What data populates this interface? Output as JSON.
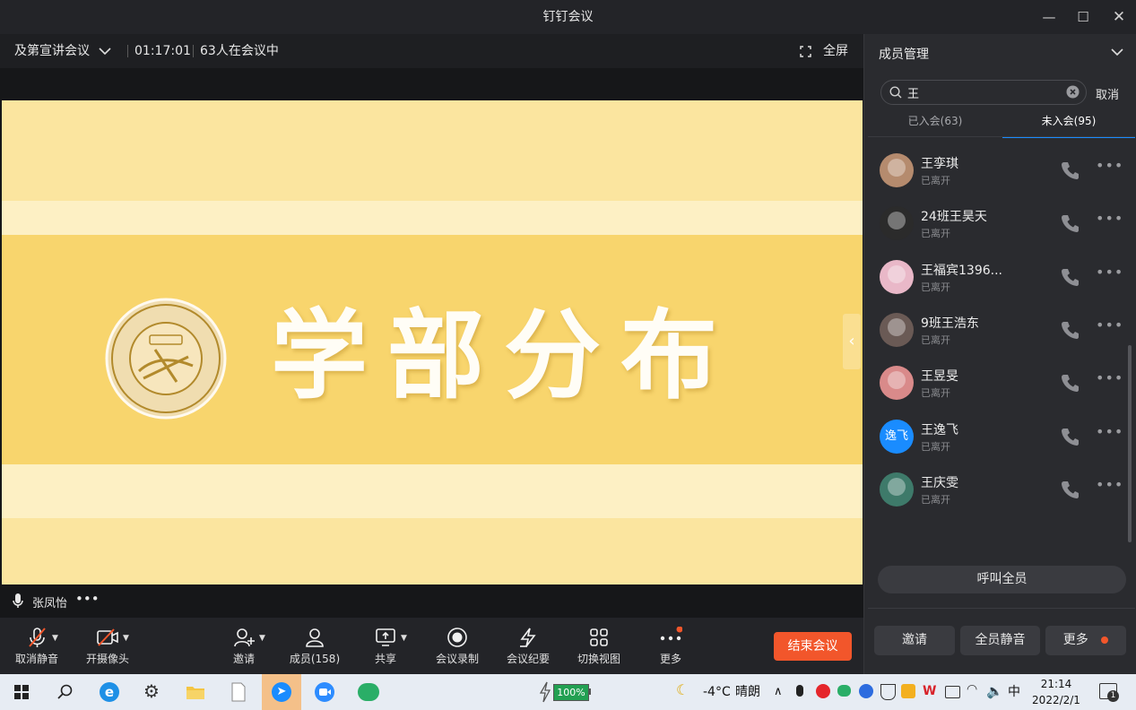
{
  "window": {
    "title": "钉钉会议"
  },
  "meeting": {
    "name": "及第宣讲会议",
    "duration": "01:17:01",
    "participants": "63人在会议中",
    "fullscreen_label": "全屏"
  },
  "slide": {
    "title": "学部分布"
  },
  "speaker": {
    "name": "张凤怡",
    "more": "•••"
  },
  "toolbar": {
    "mute": "取消静音",
    "camera": "开摄像头",
    "invite": "邀请",
    "members": "成员(158)",
    "share": "共享",
    "record": "会议录制",
    "minutes": "会议纪要",
    "view": "切换视图",
    "more": "更多",
    "end": "结束会议"
  },
  "panel": {
    "title": "成员管理",
    "search_value": "王",
    "cancel": "取消",
    "tabs": [
      {
        "label": "已入会(63)"
      },
      {
        "label": "未入会(95)"
      }
    ],
    "members": [
      {
        "name": "王孪琪",
        "status": "已离开",
        "avatar_color": "#b58b6e"
      },
      {
        "name": "24班王昊天",
        "status": "已离开",
        "avatar_color": "#2b2b2b"
      },
      {
        "name": "王福宾1396...",
        "status": "已离开",
        "avatar_color": "#e9b8c8"
      },
      {
        "name": "9班王浩东",
        "status": "已离开",
        "avatar_color": "#6a5a55"
      },
      {
        "name": "王昱旻",
        "status": "已离开",
        "avatar_color": "#d98a8a"
      },
      {
        "name": "王逸飞",
        "status": "已离开",
        "avatar_color": "#1a8cff",
        "avatar_text": "逸飞"
      },
      {
        "name": "王庆雯",
        "status": "已离开",
        "avatar_color": "#3e7a6a"
      }
    ],
    "call_all": "呼叫全员",
    "invite": "邀请",
    "mute_all": "全员静音",
    "more": "更多"
  },
  "taskbar": {
    "battery": "100%",
    "weather_temp": "-4°C",
    "weather_desc": "晴朗",
    "ime": "中",
    "time": "21:14",
    "date": "2022/2/1",
    "notification_count": "1"
  },
  "colors": {
    "accent": "#1a8cff",
    "end_button": "#f2562b",
    "slide_bg": "#fbe59f",
    "notification": "#f2562b"
  }
}
